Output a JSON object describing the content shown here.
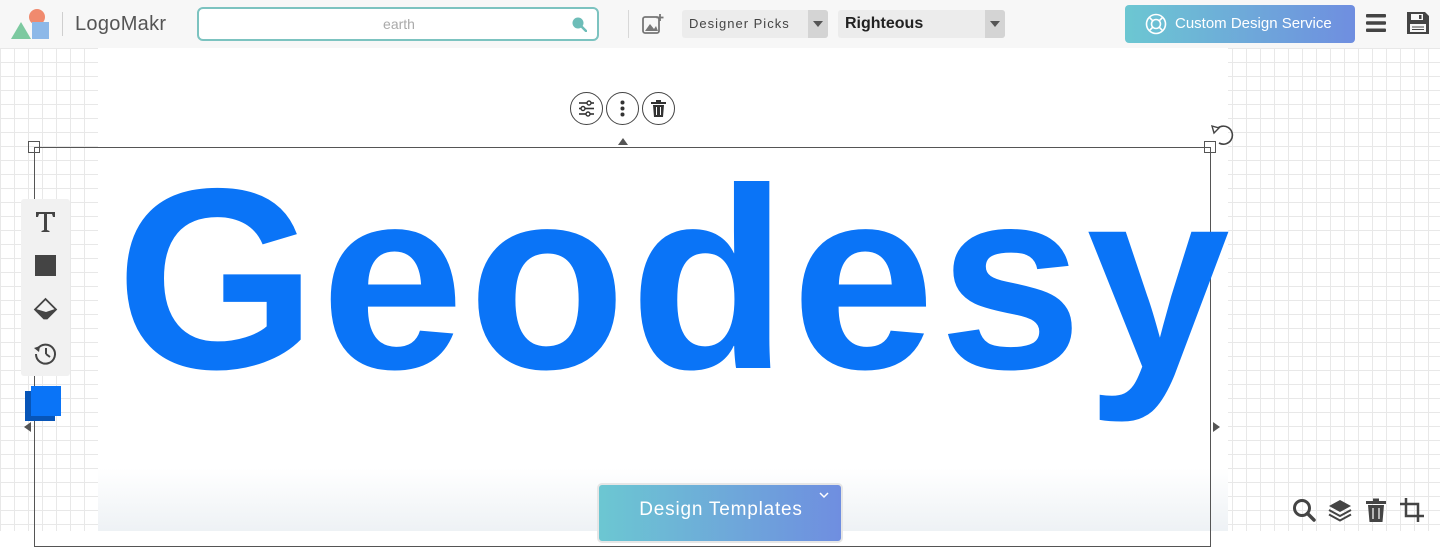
{
  "app": {
    "brand": "LogoMakr"
  },
  "search": {
    "value": "",
    "placeholder": "earth"
  },
  "dropdowns": {
    "category": "Designer Picks",
    "font": "Righteous"
  },
  "header": {
    "custom_design_label": "Custom Design Service"
  },
  "canvas": {
    "logo_text": "Geodesy",
    "text_color": "#0a74f7",
    "shadow_color": "#0755b8"
  },
  "bottom": {
    "templates_label": "Design Templates"
  },
  "colors": {
    "accent_start": "#6cc7d2",
    "accent_end": "#6f8ee0",
    "search_border": "#7cc3c0"
  },
  "icons": {
    "toolbar": [
      "image-add-icon",
      "menu-icon",
      "save-icon",
      "lifebuoy-icon"
    ],
    "selection": [
      "sliders-icon",
      "more-vertical-icon",
      "trash-icon",
      "rotate-icon"
    ],
    "tools": [
      "text-tool-icon",
      "shape-tool-icon",
      "eraser-icon",
      "history-icon"
    ],
    "bottom_right": [
      "search-icon",
      "layers-icon",
      "trash-icon",
      "crop-icon"
    ]
  }
}
